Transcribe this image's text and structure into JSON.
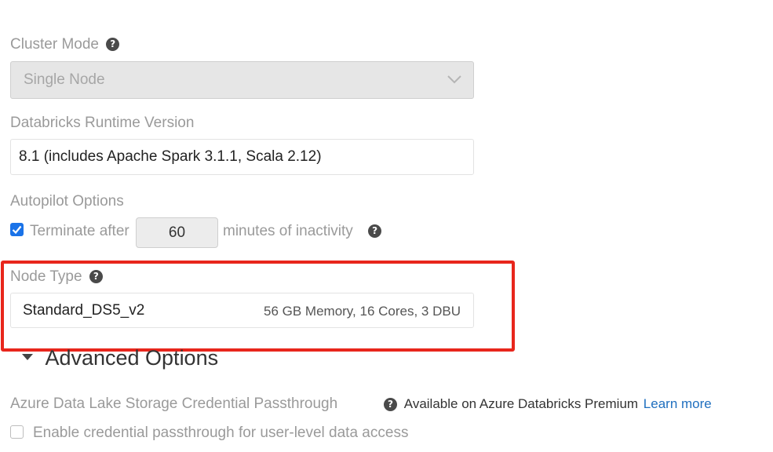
{
  "cluster_mode": {
    "label": "Cluster Mode",
    "help_icon": "?",
    "value": "Single Node"
  },
  "runtime": {
    "label": "Databricks Runtime Version",
    "value": "8.1 (includes Apache Spark 3.1.1, Scala 2.12)"
  },
  "autopilot": {
    "label": "Autopilot Options",
    "terminate_checked": true,
    "terminate_label": "Terminate after",
    "minutes_value": "60",
    "minutes_suffix": "minutes of inactivity",
    "help_icon": "?"
  },
  "node_type": {
    "label": "Node Type",
    "help_icon": "?",
    "value": "Standard_DS5_v2",
    "spec": "56 GB Memory, 16 Cores, 3 DBU"
  },
  "advanced": {
    "caret": "▼",
    "label": "Advanced Options"
  },
  "passthrough": {
    "label": "Azure Data Lake Storage Credential Passthrough",
    "help_icon": "?",
    "availability": "Available on Azure Databricks Premium",
    "learn_more": "Learn more",
    "checkbox_label": "Enable credential passthrough for user-level data access",
    "checked": false
  },
  "colors": {
    "highlight": "#e8261c",
    "link": "#1f6fbf",
    "checkbox": "#1a73e8"
  }
}
